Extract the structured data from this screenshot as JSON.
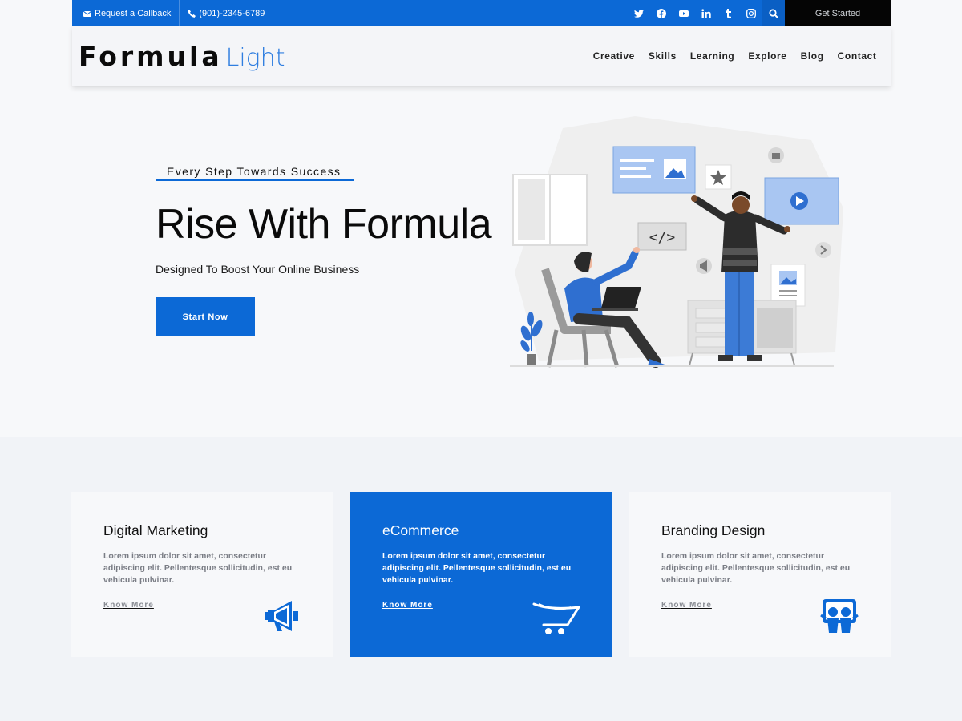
{
  "topbar": {
    "callback_label": "Request a Callback",
    "phone": "(901)-2345-6789",
    "social": [
      "twitter-icon",
      "facebook-icon",
      "youtube-icon",
      "linkedin-icon",
      "tumblr-icon",
      "instagram-icon"
    ],
    "get_started_label": "Get Started"
  },
  "header": {
    "logo_main": "Formula",
    "logo_accent": "Light",
    "nav": [
      "Creative",
      "Skills",
      "Learning",
      "Explore",
      "Blog",
      "Contact"
    ]
  },
  "hero": {
    "tagline": "Every Step Towards Success",
    "title": "Rise With Formula",
    "subtitle": "Designed To Boost Your Online Business",
    "button_label": "Start Now"
  },
  "services": [
    {
      "title": "Digital Marketing",
      "text": "Lorem ipsum dolor sit amet, consectetur adipiscing elit. Pellentesque sollicitudin, est eu vehicula pulvinar.",
      "link": "Know More",
      "icon": "megaphone-icon"
    },
    {
      "title": "eCommerce",
      "text": "Lorem ipsum dolor sit amet, consectetur adipiscing elit. Pellentesque sollicitudin, est eu vehicula pulvinar.",
      "link": "Know More",
      "icon": "cart-icon"
    },
    {
      "title": "Branding Design",
      "text": "Lorem ipsum dolor sit amet, consectetur adipiscing elit. Pellentesque sollicitudin, est eu vehicula pulvinar.",
      "link": "Know More",
      "icon": "slideshare-icon"
    }
  ],
  "colors": {
    "accent": "#0c69d6",
    "dark": "#050505",
    "background": "#f7f8fa"
  }
}
